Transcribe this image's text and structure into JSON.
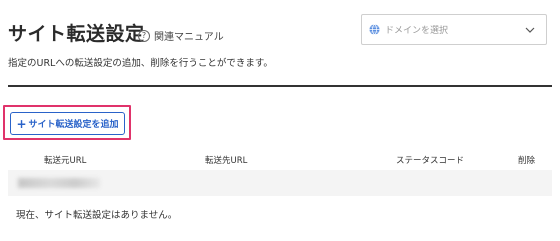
{
  "header": {
    "title": "サイト転送設定",
    "help_link": "関連マニュアル",
    "help_icon": "question-circle-icon"
  },
  "domain_select": {
    "placeholder": "ドメインを選択",
    "icon": "globe-icon"
  },
  "description": "指定のURLへの転送設定の追加、削除を行うことができます。",
  "add_button": {
    "label": "サイト転送設定を追加",
    "icon": "plus-icon"
  },
  "table": {
    "columns": [
      "転送元URL",
      "転送先URL",
      "ステータスコード",
      "削除"
    ]
  },
  "empty_message": "現在、サイト転送設定はありません。",
  "colors": {
    "accent": "#2a63c9",
    "highlight": "#e0336b"
  }
}
